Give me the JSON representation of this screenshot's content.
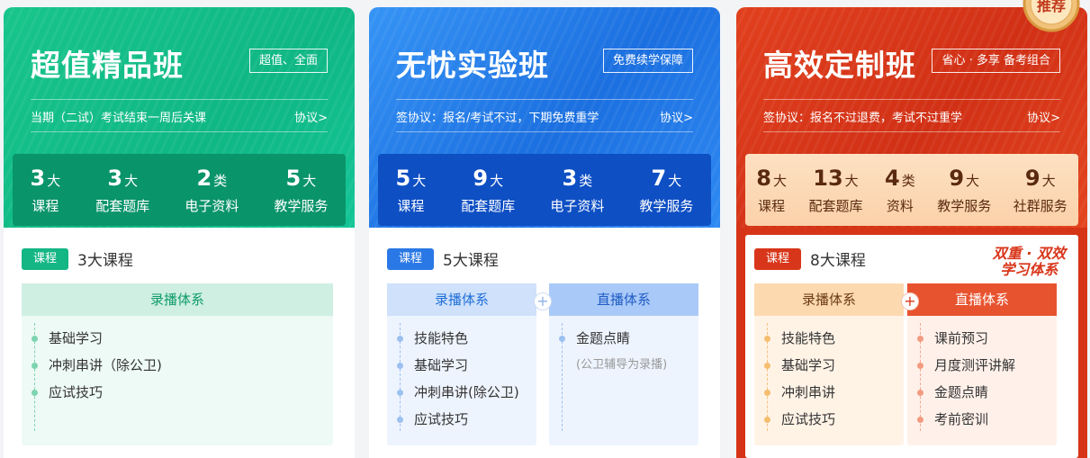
{
  "cards": [
    {
      "title": "超值精品班",
      "tag": "超值、全面",
      "agreement": "当期（二试）考试结束一周后关课",
      "agreement_link": "协议>",
      "stats": [
        {
          "num": "3",
          "unit": "大",
          "label": "课程"
        },
        {
          "num": "3",
          "unit": "大",
          "label": "配套题库"
        },
        {
          "num": "2",
          "unit": "类",
          "label": "电子资料"
        },
        {
          "num": "5",
          "unit": "大",
          "label": "教学服务"
        }
      ],
      "badge": "课程",
      "course_text": "3大课程",
      "panels": [
        {
          "title": "录播体系",
          "items": [
            "基础学习",
            "冲刺串讲（除公卫)",
            "应试技巧"
          ]
        }
      ]
    },
    {
      "title": "无忧实验班",
      "tag": "免费续学保障",
      "agreement": "签协议：报名/考试不过，下期免费重学",
      "agreement_link": "协议>",
      "stats": [
        {
          "num": "5",
          "unit": "大",
          "label": "课程"
        },
        {
          "num": "9",
          "unit": "大",
          "label": "配套题库"
        },
        {
          "num": "3",
          "unit": "类",
          "label": "电子资料"
        },
        {
          "num": "7",
          "unit": "大",
          "label": "教学服务"
        }
      ],
      "badge": "课程",
      "course_text": "5大课程",
      "panels": [
        {
          "title": "录播体系",
          "items": [
            "技能特色",
            "基础学习",
            "冲刺串讲(除公卫)",
            "应试技巧"
          ]
        },
        {
          "title": "直播体系",
          "items": [
            "金题点睛"
          ],
          "note": "(公卫辅导为录播)"
        }
      ]
    },
    {
      "title": "高效定制班",
      "tag": "省心 · 多享 备考组合",
      "agreement": "签协议：报名不过退费，考试不过重学",
      "agreement_link": "协议>",
      "stats": [
        {
          "num": "8",
          "unit": "大",
          "label": "课程"
        },
        {
          "num": "13",
          "unit": "大",
          "label": "配套题库"
        },
        {
          "num": "4",
          "unit": "类",
          "label": "资料"
        },
        {
          "num": "9",
          "unit": "大",
          "label": "教学服务"
        },
        {
          "num": "9",
          "unit": "大",
          "label": "社群服务"
        }
      ],
      "badge": "课程",
      "course_text": "8大课程",
      "slogan_line1": "双重 · 双效",
      "slogan_line2": "学习体系",
      "panels": [
        {
          "title": "录播体系",
          "items": [
            "技能特色",
            "基础学习",
            "冲刺串讲",
            "应试技巧"
          ]
        },
        {
          "title": "直播体系",
          "items": [
            "课前预习",
            "月度测评讲解",
            "金题点睛",
            "考前密训"
          ]
        }
      ]
    }
  ],
  "ribbon_label": "推荐",
  "plus_symbol": "+",
  "colors": {
    "green": "#14b684",
    "blue": "#2a78e6",
    "red": "#d8361a"
  }
}
